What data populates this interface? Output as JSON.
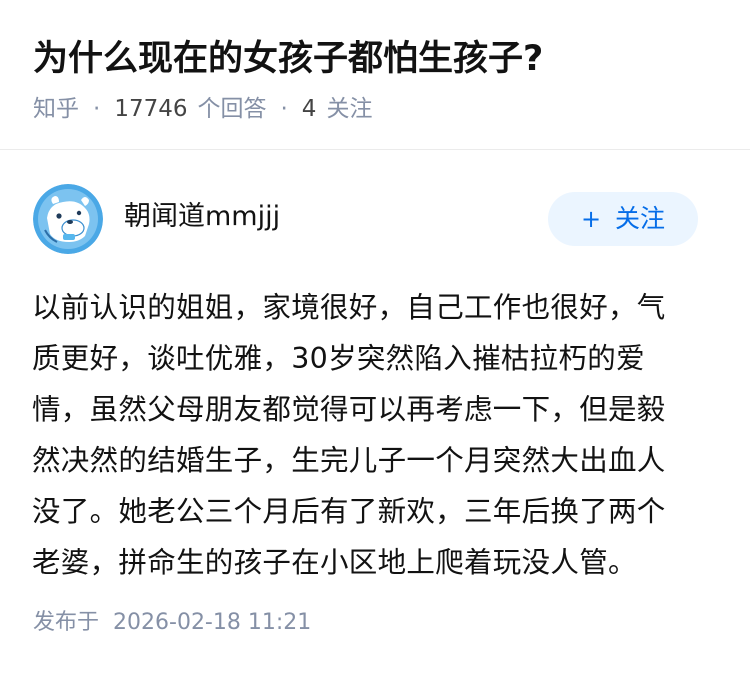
{
  "question": {
    "title": "为什么现在的女孩子都怕生孩子?",
    "source": "知乎",
    "answer_count": "17746",
    "answer_label": "个回答",
    "follower_count": "4",
    "follower_label": "关注"
  },
  "author": {
    "name": "朝闻道mmjjj",
    "follow_label": "关注"
  },
  "answer": {
    "lines": [
      "以前认识的姐姐，家境很好，自己工作也很好，气",
      "质更好，谈吐优雅，30岁突然陷入摧枯拉朽的爱",
      "情，虽然父母朋友都觉得可以再考虑一下，但是毅",
      "然决然的结婚生子，生完儿子一个月突然大出血人",
      "没了。她老公三个月后有了新欢，三年后换了两个",
      "老婆，拼命生的孩子在小区地上爬着玩没人管。"
    ]
  },
  "publish": {
    "label": "发布于",
    "time": "2026-02-18 11:21"
  },
  "colors": {
    "accent": "#056de8",
    "follow_bg": "#ebf5ff",
    "meta": "#8590a6",
    "avatar_bg": "#4aa8e6"
  },
  "icons": {
    "avatar": "avatar-bear-icon",
    "follow": "plus-icon"
  }
}
